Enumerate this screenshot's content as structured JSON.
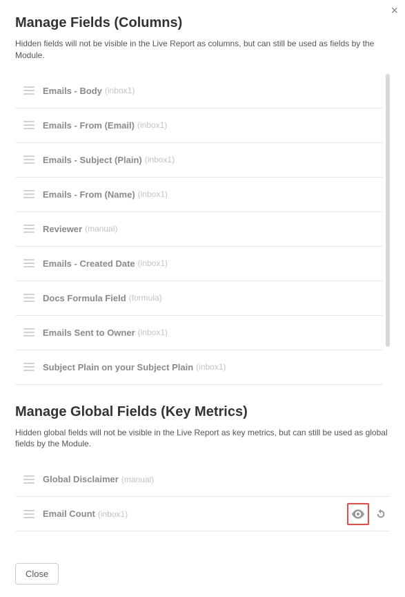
{
  "close_label": "×",
  "section1": {
    "title": "Manage Fields (Columns)",
    "subtitle": "Hidden fields will not be visible in the Live Report as columns, but can still be used as fields by the Module.",
    "fields": [
      {
        "label": "Emails - Body",
        "source": "(inbox1)"
      },
      {
        "label": "Emails - From (Email)",
        "source": "(inbox1)"
      },
      {
        "label": "Emails - Subject (Plain)",
        "source": "(inbox1)"
      },
      {
        "label": "Emails - From (Name)",
        "source": "(inbox1)"
      },
      {
        "label": "Reviewer",
        "source": "(manual)"
      },
      {
        "label": "Emails - Created Date",
        "source": "(inbox1)"
      },
      {
        "label": "Docs Formula Field",
        "source": "(formula)"
      },
      {
        "label": "Emails Sent to Owner",
        "source": "(inbox1)"
      },
      {
        "label": "Subject Plain on your Subject Plain",
        "source": "(inbox1)"
      }
    ]
  },
  "section2": {
    "title": "Manage Global Fields (Key Metrics)",
    "subtitle": "Hidden global fields will not be visible in the Live Report as key metrics, but can still be used as global fields by the Module.",
    "fields": [
      {
        "label": "Global Disclaimer",
        "source": "(manual)",
        "actions": false
      },
      {
        "label": "Email Count",
        "source": "(inbox1)",
        "actions": true,
        "highlight": true
      }
    ]
  },
  "footer": {
    "close_button": "Close"
  }
}
